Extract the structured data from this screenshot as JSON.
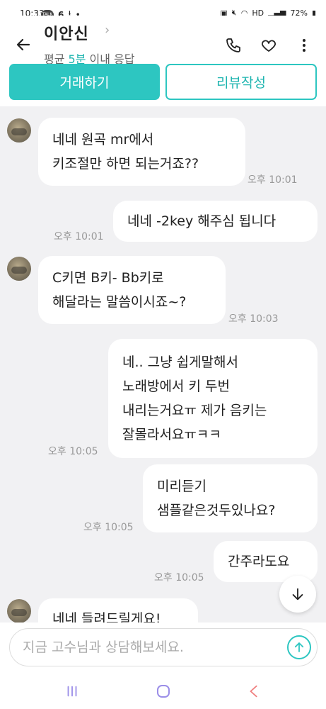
{
  "status_bar": {
    "time": "10:33",
    "talk_badge": "TALK",
    "network": "HD",
    "battery": "72%"
  },
  "header": {
    "name": "이안신",
    "response_prefix": "평균 ",
    "response_highlight": "5분",
    "response_suffix": " 이내 응답"
  },
  "actions": {
    "deal_label": "거래하기",
    "review_label": "리뷰작성"
  },
  "messages": [
    {
      "side": "left",
      "text": "네네 원곡 mr에서\n키조절만 하면 되는거죠??",
      "time": "오후 10:01"
    },
    {
      "side": "right",
      "text": "네네 -2key 해주심 됩니다",
      "time": "오후 10:01"
    },
    {
      "side": "left",
      "text": "C키면 B키- Bb키로\n해달라는 말씀이시죠~?",
      "time": "오후 10:03"
    },
    {
      "side": "right",
      "text": "네.. 그냥 쉽게말해서\n노래방에서 키 두번\n내리는거요ㅠ 제가 음키는\n잘몰라서요ㅠㅋㅋ",
      "time": "오후 10:05"
    },
    {
      "side": "right",
      "text": "미리듣기\n샘플같은것두있나요?",
      "time": "오후 10:05"
    },
    {
      "side": "right",
      "text": "간주라도요",
      "time": "오후 10:05"
    },
    {
      "side": "left",
      "text": "네네 들려드릴게요!",
      "time": ""
    }
  ],
  "input": {
    "placeholder": "지금 고수님과 상담해보세요."
  },
  "colors": {
    "accent": "#2dc6c1",
    "chat_bg": "#f1f1f3"
  }
}
